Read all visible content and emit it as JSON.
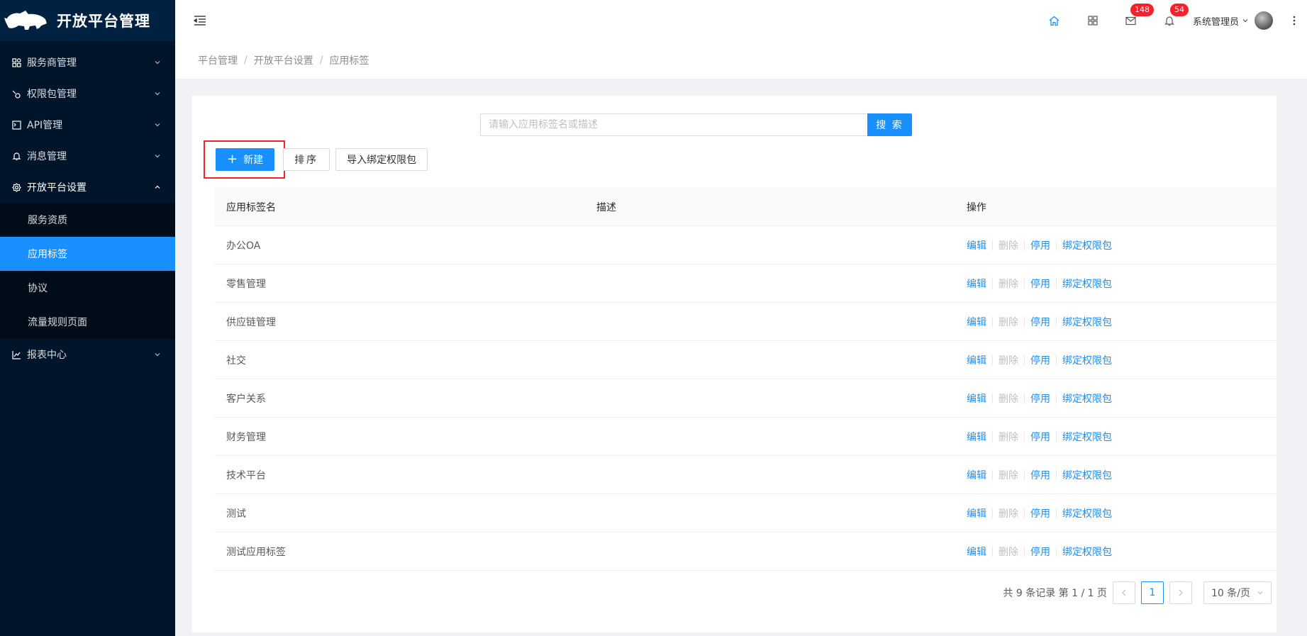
{
  "app": {
    "title": "开放平台管理"
  },
  "sidebar": {
    "items": [
      {
        "label": "服务商管理",
        "icon": "appstore-icon"
      },
      {
        "label": "权限包管理",
        "icon": "api-link-icon"
      },
      {
        "label": "API管理",
        "icon": "api-box-icon"
      },
      {
        "label": "消息管理",
        "icon": "bell-icon"
      },
      {
        "label": "开放平台设置",
        "icon": "setting-icon"
      },
      {
        "label": "报表中心",
        "icon": "line-chart-icon"
      }
    ],
    "submenu": [
      "服务资质",
      "应用标签",
      "协议",
      "流量规则页面"
    ],
    "active_sub": "应用标签"
  },
  "header": {
    "mail_badge": "148",
    "bell_badge": "54",
    "user_name": "系统管理员"
  },
  "breadcrumb": [
    "平台管理",
    "开放平台设置",
    "应用标签"
  ],
  "search": {
    "placeholder": "请输入应用标签名或描述",
    "value": "",
    "button": "搜 索"
  },
  "toolbar": {
    "new_label": "新建",
    "sort_label": "排序",
    "import_label": "导入绑定权限包"
  },
  "table": {
    "columns": [
      "应用标签名",
      "描述",
      "操作"
    ],
    "rows": [
      {
        "name": "办公OA",
        "desc": ""
      },
      {
        "name": "零售管理",
        "desc": ""
      },
      {
        "name": "供应链管理",
        "desc": ""
      },
      {
        "name": "社交",
        "desc": ""
      },
      {
        "name": "客户关系",
        "desc": ""
      },
      {
        "name": "财务管理",
        "desc": ""
      },
      {
        "name": "技术平台",
        "desc": ""
      },
      {
        "name": "测试",
        "desc": ""
      },
      {
        "name": "测试应用标签",
        "desc": ""
      }
    ],
    "actions": {
      "edit": "编辑",
      "delete": "删除",
      "disable": "停用",
      "bind": "绑定权限包"
    }
  },
  "pagination": {
    "summary": "共 9 条记录 第 1 / 1 页",
    "current_page": "1",
    "page_size": "10 条/页"
  },
  "colors": {
    "primary": "#1890ff",
    "sidebar_bg": "#001529",
    "badge": "#f5222d",
    "highlight": "#f5222d"
  }
}
